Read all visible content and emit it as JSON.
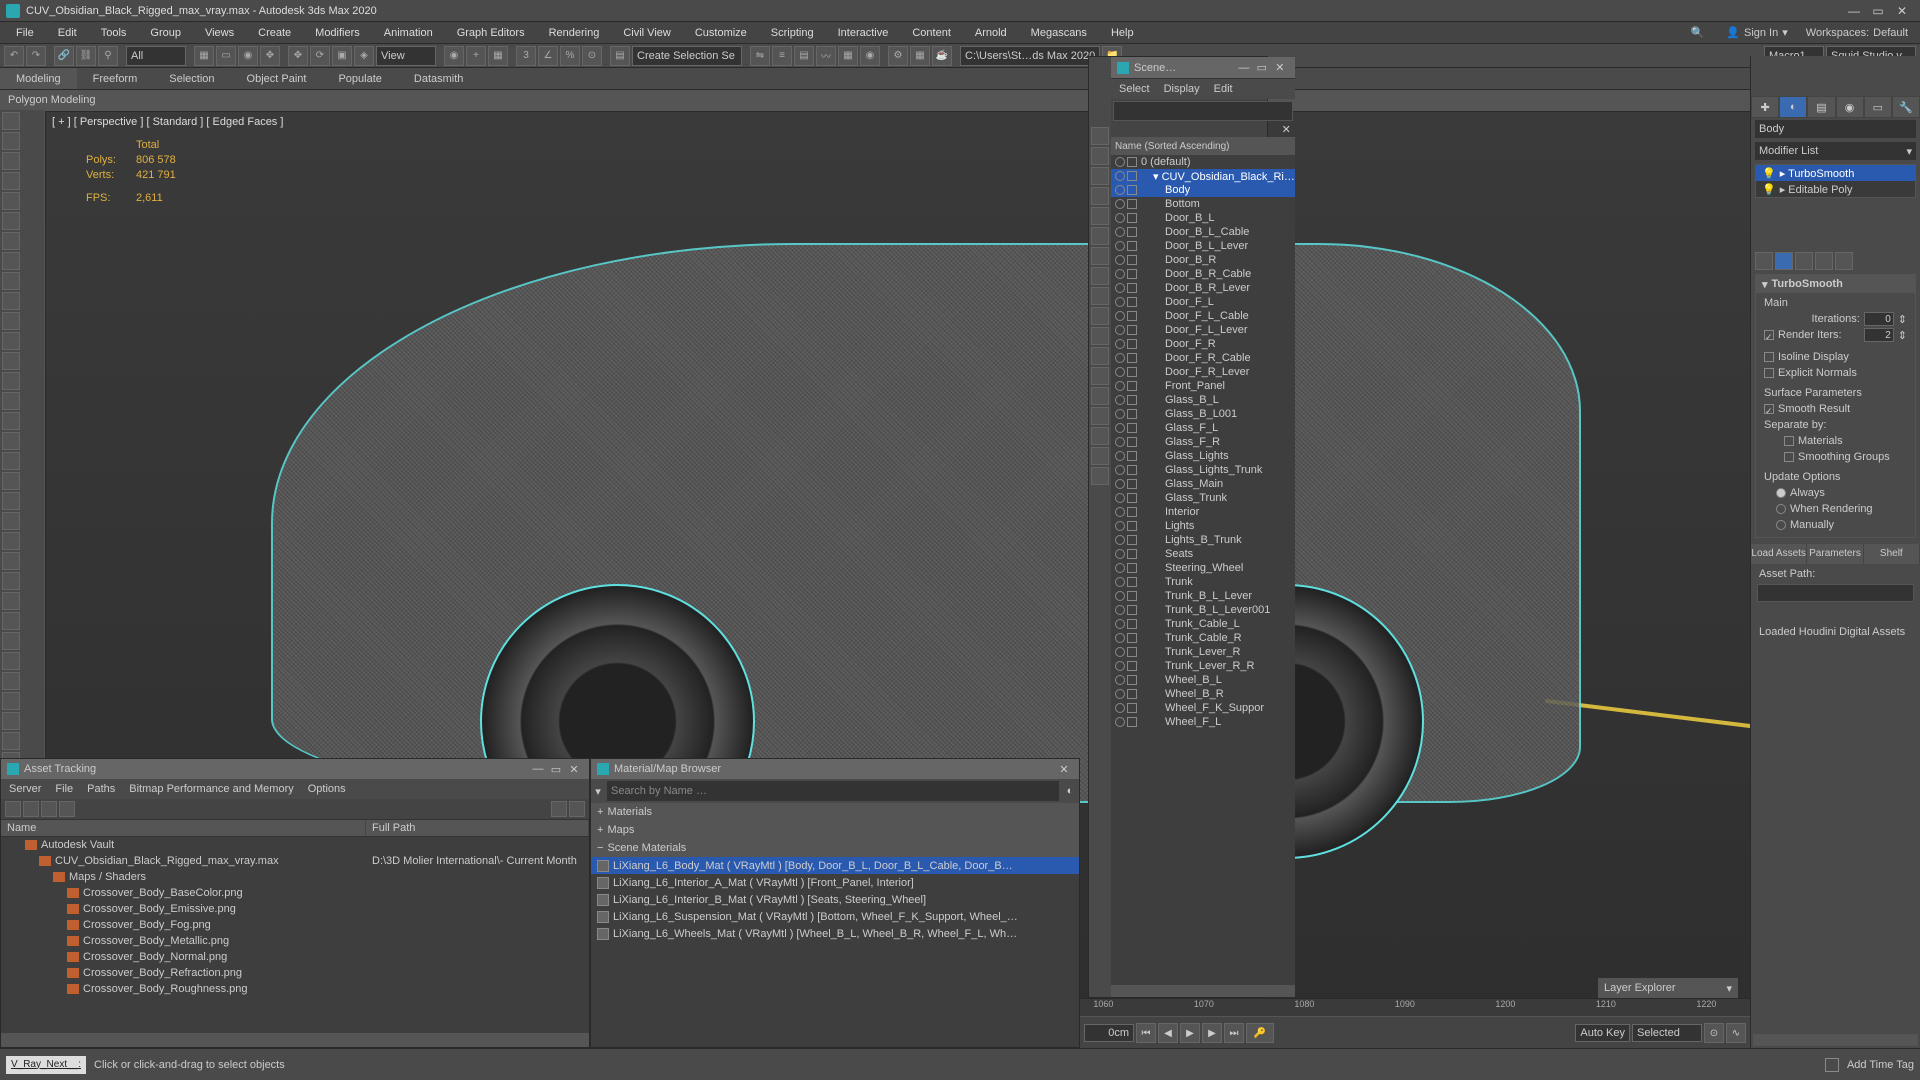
{
  "title": "CUV_Obsidian_Black_Rigged_max_vray.max - Autodesk 3ds Max 2020",
  "menus": [
    "File",
    "Edit",
    "Tools",
    "Group",
    "Views",
    "Create",
    "Modifiers",
    "Animation",
    "Graph Editors",
    "Rendering",
    "Civil View",
    "Customize",
    "Scripting",
    "Interactive",
    "Content",
    "Arnold",
    "Megascans",
    "Help"
  ],
  "signin": "Sign In",
  "workspaces_label": "Workspaces:",
  "workspaces_value": "Default",
  "toolbar": {
    "all": "All",
    "view": "View",
    "create_sel": "Create Selection Se",
    "path": "C:\\Users\\St…ds Max 2020",
    "macro": "Macro1",
    "studio": "Squid Studio v"
  },
  "ribbon_tabs": [
    "Modeling",
    "Freeform",
    "Selection",
    "Object Paint",
    "Populate",
    "Datasmith"
  ],
  "ribbon_active": 0,
  "ribbon_sub": "Polygon Modeling",
  "viewport": {
    "label": "[ + ] [ Perspective ] [ Standard ] [ Edged Faces ]",
    "stats_total": "Total",
    "polys_k": "Polys:",
    "polys_v": "806 578",
    "verts_k": "Verts:",
    "verts_v": "421 791",
    "fps_k": "FPS:",
    "fps_v": "2,611"
  },
  "scene": {
    "title": "Scene…",
    "menus": [
      "Select",
      "Display",
      "Edit"
    ],
    "header": "Name (Sorted Ascending)",
    "root": "0 (default)",
    "group": "CUV_Obsidian_Black_Ri…",
    "selected": "Body",
    "items": [
      "Body",
      "Bottom",
      "Door_B_L",
      "Door_B_L_Cable",
      "Door_B_L_Lever",
      "Door_B_R",
      "Door_B_R_Cable",
      "Door_B_R_Lever",
      "Door_F_L",
      "Door_F_L_Cable",
      "Door_F_L_Lever",
      "Door_F_R",
      "Door_F_R_Cable",
      "Door_F_R_Lever",
      "Front_Panel",
      "Glass_B_L",
      "Glass_B_L001",
      "Glass_F_L",
      "Glass_F_R",
      "Glass_Lights",
      "Glass_Lights_Trunk",
      "Glass_Main",
      "Glass_Trunk",
      "Interior",
      "Lights",
      "Lights_B_Trunk",
      "Seats",
      "Steering_Wheel",
      "Trunk",
      "Trunk_B_L_Lever",
      "Trunk_B_L_Lever001",
      "Trunk_Cable_L",
      "Trunk_Cable_R",
      "Trunk_Lever_R",
      "Trunk_Lever_R_R",
      "Wheel_B_L",
      "Wheel_B_R",
      "Wheel_F_K_Suppor",
      "Wheel_F_L"
    ],
    "layer_explorer": "Layer Explorer"
  },
  "command": {
    "obj_name": "Body",
    "modlist": "Modifier List",
    "stack": [
      "TurboSmooth",
      "Editable Poly"
    ],
    "stack_sel": 0,
    "rollout_name": "TurboSmooth",
    "main": "Main",
    "iterations_l": "Iterations:",
    "iterations_v": "0",
    "render_iters_l": "Render Iters:",
    "render_iters_v": "2",
    "isoline": "Isoline Display",
    "explicit": "Explicit Normals",
    "surf_params": "Surface Parameters",
    "smooth_result": "Smooth Result",
    "separate": "Separate by:",
    "sep_mat": "Materials",
    "sep_sg": "Smoothing Groups",
    "update": "Update Options",
    "u_always": "Always",
    "u_render": "When Rendering",
    "u_manual": "Manually",
    "param_tabs": [
      "Load Assets",
      "Parameters",
      "Shelf"
    ],
    "asset_path": "Asset Path:",
    "houdini": "Loaded Houdini Digital Assets"
  },
  "asset_tracking": {
    "title": "Asset Tracking",
    "menus": [
      "Server",
      "File",
      "Paths",
      "Bitmap Performance and Memory",
      "Options"
    ],
    "col_name": "Name",
    "col_path": "Full Path",
    "rows": [
      {
        "indent": 1,
        "icon": "vault",
        "name": "Autodesk Vault",
        "path": ""
      },
      {
        "indent": 2,
        "icon": "max",
        "name": "CUV_Obsidian_Black_Rigged_max_vray.max",
        "path": "D:\\3D Molier International\\- Current Month"
      },
      {
        "indent": 3,
        "icon": "folder",
        "name": "Maps / Shaders",
        "path": ""
      },
      {
        "indent": 4,
        "icon": "png",
        "name": "Crossover_Body_BaseColor.png",
        "path": ""
      },
      {
        "indent": 4,
        "icon": "png",
        "name": "Crossover_Body_Emissive.png",
        "path": ""
      },
      {
        "indent": 4,
        "icon": "png",
        "name": "Crossover_Body_Fog.png",
        "path": ""
      },
      {
        "indent": 4,
        "icon": "png",
        "name": "Crossover_Body_Metallic.png",
        "path": ""
      },
      {
        "indent": 4,
        "icon": "png",
        "name": "Crossover_Body_Normal.png",
        "path": ""
      },
      {
        "indent": 4,
        "icon": "png",
        "name": "Crossover_Body_Refraction.png",
        "path": ""
      },
      {
        "indent": 4,
        "icon": "png",
        "name": "Crossover_Body_Roughness.png",
        "path": ""
      }
    ]
  },
  "material_browser": {
    "title": "Material/Map Browser",
    "search_ph": "Search by Name …",
    "cat_materials": "Materials",
    "cat_maps": "Maps",
    "cat_scene": "Scene Materials",
    "items": [
      "LiXiang_L6_Body_Mat ( VRayMtl )  [Body, Door_B_L, Door_B_L_Cable, Door_B…",
      "LiXiang_L6_Interior_A_Mat ( VRayMtl )  [Front_Panel, Interior]",
      "LiXiang_L6_Interior_B_Mat ( VRayMtl )  [Seats, Steering_Wheel]",
      "LiXiang_L6_Suspension_Mat ( VRayMtl )  [Bottom, Wheel_F_K_Support, Wheel_…",
      "LiXiang_L6_Wheels_Mat ( VRayMtl )  [Wheel_B_L, Wheel_B_R, Wheel_F_L, Wh…"
    ],
    "selected": 0
  },
  "timeline": {
    "frame_field": "0cm",
    "ticks": [
      "1060",
      "1070",
      "1080",
      "1090",
      "1200",
      "1210",
      "1220"
    ],
    "auto_key": "Auto Key",
    "set_key": "Set Key",
    "selected": "Selected",
    "key_filters": "Key Filters…",
    "add_time_tag": "Add Time Tag"
  },
  "status": {
    "renderer": "V_Ray_Next__:",
    "prompt": "Click or click-and-drag to select objects"
  }
}
